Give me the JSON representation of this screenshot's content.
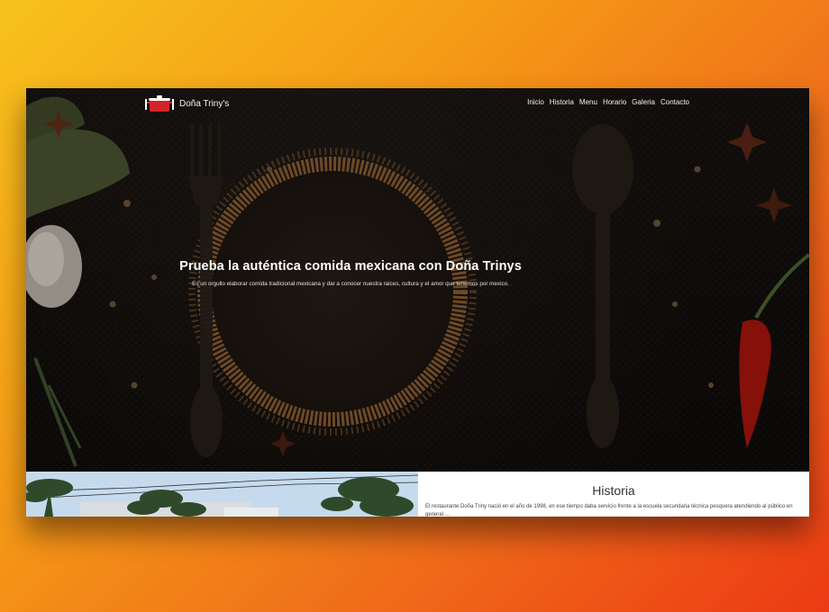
{
  "brand": {
    "name": "Doña Triny's",
    "icon": "cooking-pot-icon"
  },
  "nav": {
    "items": [
      "Inicio",
      "Historia",
      "Menu",
      "Horario",
      "Galeria",
      "Contacto"
    ]
  },
  "hero": {
    "title": "Prueba la auténtica comida mexicana con Doña Trinys",
    "subtitle": "Es un orgullo elaborar comida tradicional mexicana y dar a conocer nuestra raices, cultura y el amor que tenemos por mexico."
  },
  "historia": {
    "title": "Historia",
    "text": "El restaurante Doña Triny nació en el año de 1998, en ese tiempo daba servicio frente a la escuela secundaria técnica pesquera atendiendo al público en general ..."
  },
  "colors": {
    "background_start": "#f7c21c",
    "background_end": "#ec3a14",
    "hero_dark": "#1a1511",
    "pot_red": "#d8222a"
  }
}
